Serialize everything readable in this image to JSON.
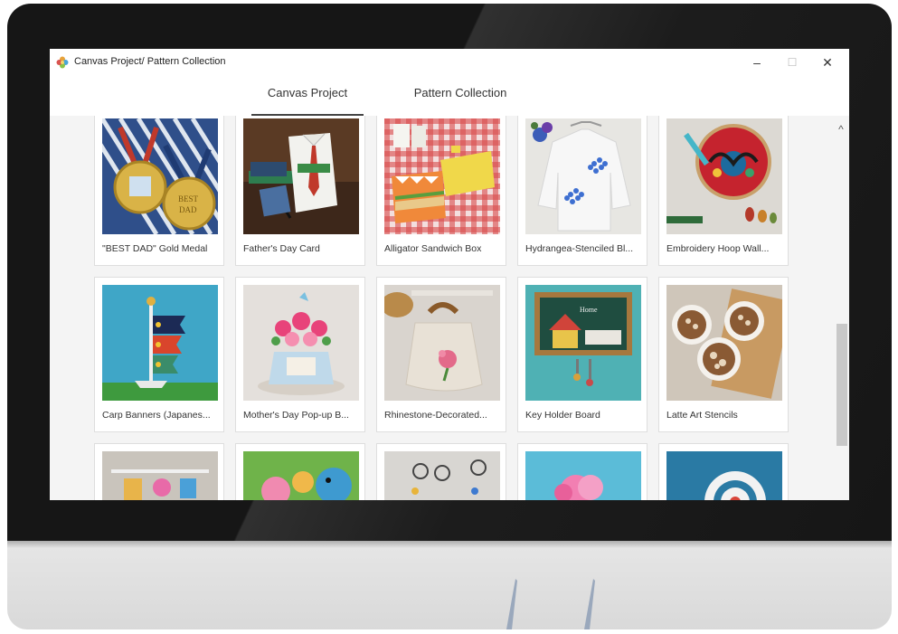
{
  "window": {
    "title": "Canvas Project/ Pattern Collection",
    "app_icon": "flower-icon",
    "controls": {
      "minimize": "–",
      "maximize": "☐",
      "close": "✕"
    }
  },
  "tabs": [
    {
      "label": "Canvas Project",
      "active": true
    },
    {
      "label": "Pattern Collection",
      "active": false
    }
  ],
  "projects": [
    {
      "label": "\"BEST DAD\" Gold Medal",
      "image": "gold-medals"
    },
    {
      "label": "Father's Day Card",
      "image": "shirt-card"
    },
    {
      "label": "Alligator Sandwich Box",
      "image": "alligator-box"
    },
    {
      "label": "Hydrangea-Stenciled Bl...",
      "image": "stenciled-blouse"
    },
    {
      "label": "Embroidery Hoop Wall...",
      "image": "embroidery-hoop"
    },
    {
      "label": "Carp Banners (Japanes...",
      "image": "carp-banners"
    },
    {
      "label": "Mother's Day Pop-up B...",
      "image": "popup-bouquet"
    },
    {
      "label": "Rhinestone-Decorated...",
      "image": "rhinestone-bag"
    },
    {
      "label": "Key Holder Board",
      "image": "key-holder"
    },
    {
      "label": "Latte Art Stencils",
      "image": "latte-art"
    },
    {
      "label": "",
      "image": "hanging-decor"
    },
    {
      "label": "",
      "image": "bird-figures"
    },
    {
      "label": "",
      "image": "wire-flowers"
    },
    {
      "label": "",
      "image": "pink-flower"
    },
    {
      "label": "",
      "image": "lace-doily"
    }
  ],
  "colors": {
    "content_bg": "#f4f4f4",
    "active_tab_underline": "#444444",
    "monitor_bezel": "#161616"
  },
  "scrollbar": {
    "up_icon": "^"
  }
}
